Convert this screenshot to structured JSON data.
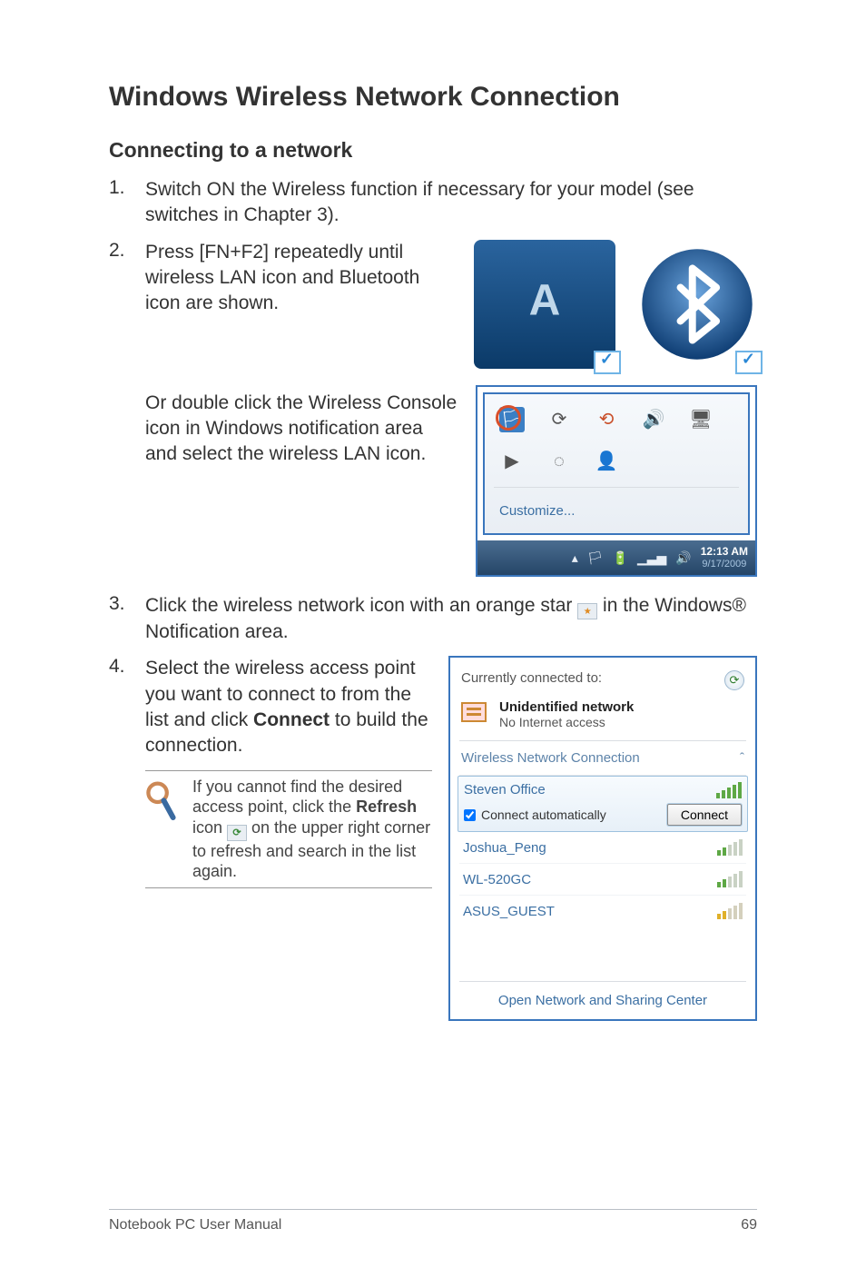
{
  "heading": "Windows Wireless Network Connection",
  "subheading": "Connecting to a network",
  "steps": {
    "s1": {
      "num": "1.",
      "text": "Switch ON the Wireless function if necessary for your model (see switches in Chapter 3)."
    },
    "s2": {
      "num": "2.",
      "text": "Press [FN+F2] repeatedly until wireless LAN icon and Bluetooth icon are shown."
    },
    "s2b": {
      "text": "Or double click the Wireless Console icon in Windows notification area and select the wireless LAN icon."
    },
    "s3": {
      "num": "3.",
      "text_before": "Click the wireless network icon with an orange star ",
      "text_after": " in the Windows® Notification area."
    },
    "s4": {
      "num": "4.",
      "text_before": "Select the wireless access point you want to connect to from the list and click ",
      "bold": "Connect",
      "text_after": " to build the connection."
    }
  },
  "note": {
    "text_before": "If you cannot find the desired access point, click the ",
    "bold": "Refresh",
    "text_mid": " icon ",
    "text_after": " on the upper right corner to refresh and search in the list again."
  },
  "tray": {
    "customize": "Customize...",
    "clock_time": "12:13 AM",
    "clock_date": "9/17/2009"
  },
  "netpopup": {
    "connected_to": "Currently connected to:",
    "unid_title": "Unidentified network",
    "unid_sub": "No Internet access",
    "section": "Wireless Network Connection",
    "items": [
      {
        "name": "Steven Office"
      },
      {
        "name": "Joshua_Peng"
      },
      {
        "name": "WL-520GC"
      },
      {
        "name": "ASUS_GUEST"
      }
    ],
    "auto_label": "Connect automatically",
    "connect_btn": "Connect",
    "footer": "Open Network and Sharing Center"
  },
  "footer": {
    "left": "Notebook PC User Manual",
    "right": "69"
  }
}
